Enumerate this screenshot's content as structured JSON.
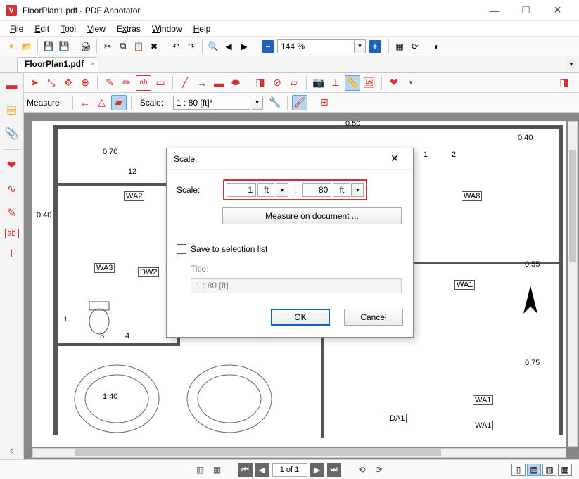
{
  "titlebar": {
    "text": "FloorPlan1.pdf - PDF Annotator"
  },
  "menu": {
    "file": "File",
    "edit": "Edit",
    "tool": "Tool",
    "view": "View",
    "extras": "Extras",
    "window": "Window",
    "help": "Help"
  },
  "zoom": {
    "value": "144 %"
  },
  "tab": {
    "label": "FloorPlan1.pdf"
  },
  "measurebar": {
    "label": "Measure",
    "scale_label": "Scale:",
    "scale_value": "1 : 80 [ft]*"
  },
  "doc_labels": {
    "d050": "0.50",
    "d040a": "0.40",
    "d070": "0.70",
    "d040b": "0.40",
    "d055": "0.55",
    "d075": "0.75",
    "d140": "1.40",
    "wa2": "WA2",
    "wa3": "WA3",
    "wa8": "WA8",
    "wa1a": "WA1",
    "wa1b": "WA1",
    "wa1c": "WA1",
    "dw2": "DW2",
    "da1": "DA1",
    "n1": "1",
    "n12": "12",
    "n2": "2",
    "n3": "3",
    "n4": "4"
  },
  "dialog": {
    "title": "Scale",
    "scale_label": "Scale:",
    "left_value": "1",
    "left_unit": "ft",
    "colon": ":",
    "right_value": "80",
    "right_unit": "ft",
    "measure_btn": "Measure on document ...",
    "save_check": "Save to selection list",
    "title_label": "Title:",
    "title_value": "1 : 80 [ft]",
    "ok": "OK",
    "cancel": "Cancel"
  },
  "page_nav": {
    "label": "1 of 1"
  }
}
